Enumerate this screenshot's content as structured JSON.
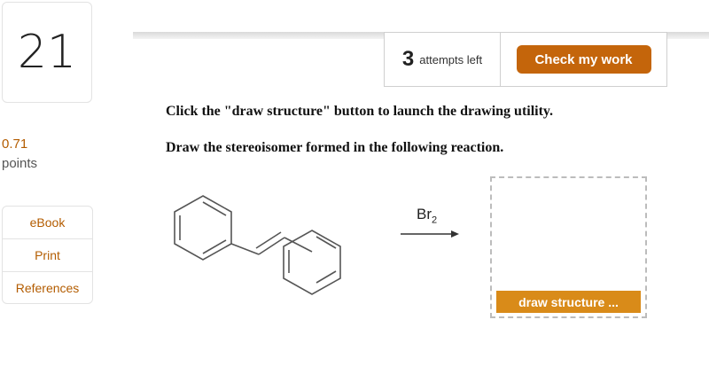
{
  "question": {
    "number": "21"
  },
  "points": {
    "value": "0.71",
    "label": "points"
  },
  "side_links": [
    {
      "label": "eBook"
    },
    {
      "label": "Print"
    },
    {
      "label": "References"
    }
  ],
  "attempts": {
    "count": "3",
    "label": "attempts left"
  },
  "check_button": {
    "label": "Check my work"
  },
  "instructions": {
    "line1": "Click the \"draw structure\" button to launch the drawing utility.",
    "line2": "Draw the stereoisomer formed in the following reaction."
  },
  "reaction": {
    "reactant": "trans-stilbene-structure",
    "reagent_main": "Br",
    "reagent_sub": "2",
    "arrow": "right-arrow-icon"
  },
  "draw_button": {
    "label": "draw structure ..."
  },
  "colors": {
    "accent": "#c4650b",
    "draw_button": "#d98b19",
    "link": "#b35c00"
  }
}
